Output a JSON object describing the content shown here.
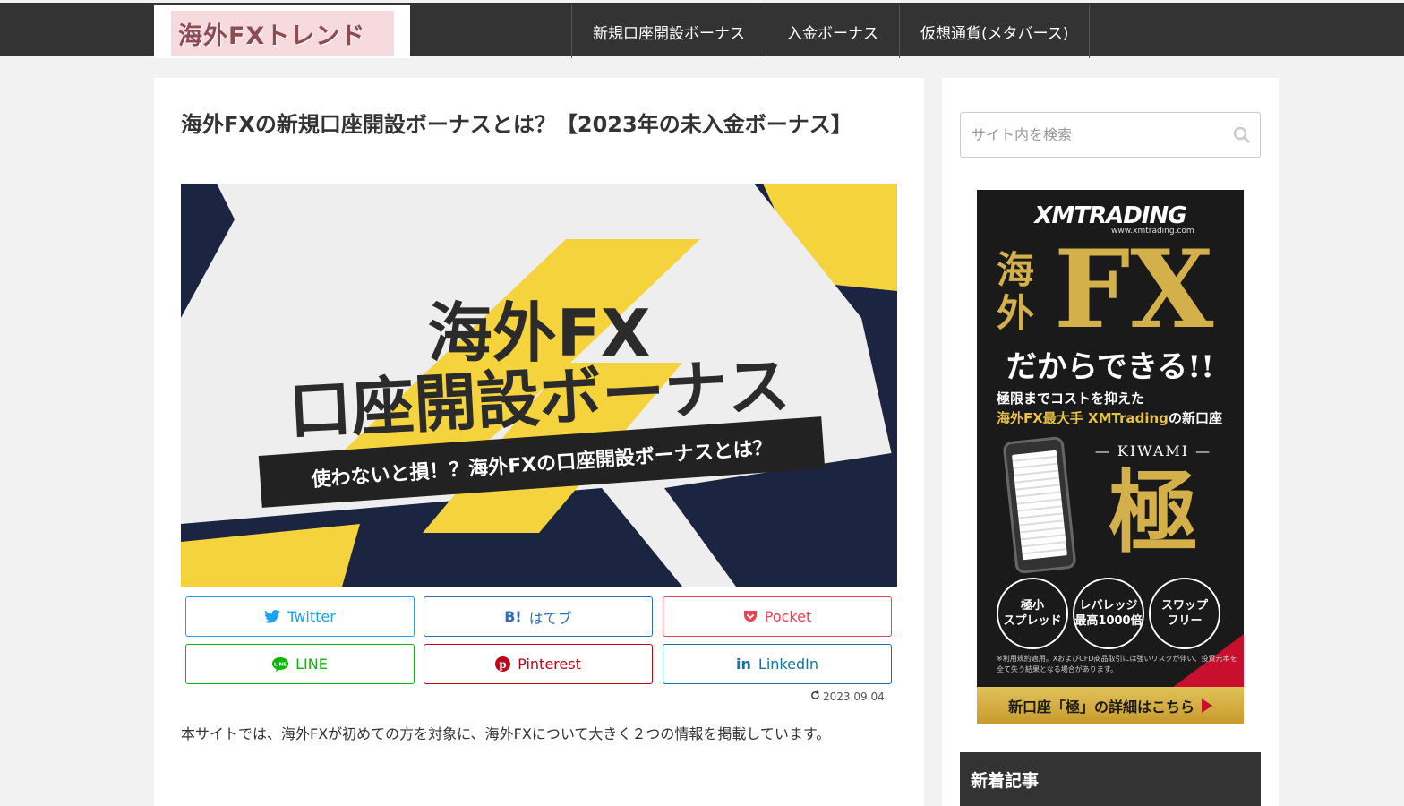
{
  "header": {
    "logo_text": "海外FXトレンド",
    "nav": [
      "新規口座開設ボーナス",
      "入金ボーナス",
      "仮想通貨(メタバース)"
    ]
  },
  "article": {
    "title": "海外FXの新規口座開設ボーナスとは？【2023年の未入金ボーナス】",
    "hero": {
      "line1": "海外FX",
      "line2": "口座開設ボーナス",
      "banner": "使わないと損！？海外FXの口座開設ボーナスとは？",
      "colors": {
        "navy": "#1b2440",
        "yellow": "#f5d33c",
        "paper": "#eeeeee"
      }
    },
    "share": {
      "twitter": "Twitter",
      "hatebu": "はてブ",
      "pocket": "Pocket",
      "line": "LINE",
      "pinterest": "Pinterest",
      "linkedin": "LinkedIn"
    },
    "updated": "2023.09.04",
    "intro": "本サイトでは、海外FXが初めての方を対象に、海外FXについて大きく２つの情報を掲載しています。"
  },
  "sidebar": {
    "search_placeholder": "サイト内を検索",
    "ad": {
      "brand": "XMTRADING",
      "url": "www.xmtrading.com",
      "kaigai": "海外",
      "fx": "FX",
      "dakara": "だからできる!!",
      "sub1": "極限までコストを抑えた",
      "sub2_gold": "海外FX最大手 XMTrading",
      "sub2_rest": "の新口座",
      "kiwami_label": "— KIWAMI —",
      "kiwami_kanji": "極",
      "circles": [
        "極小\nスプレッド",
        "レバレッジ\n最高1000倍",
        "スワップ\nフリー"
      ],
      "note": "※利用規約適用。XおよびCFD商品取引には強いリスクが伴い、投資元本を全て失う結果となる場合があります。",
      "cta": "新口座「極」の詳細はこちら"
    },
    "new_posts_heading": "新着記事"
  }
}
